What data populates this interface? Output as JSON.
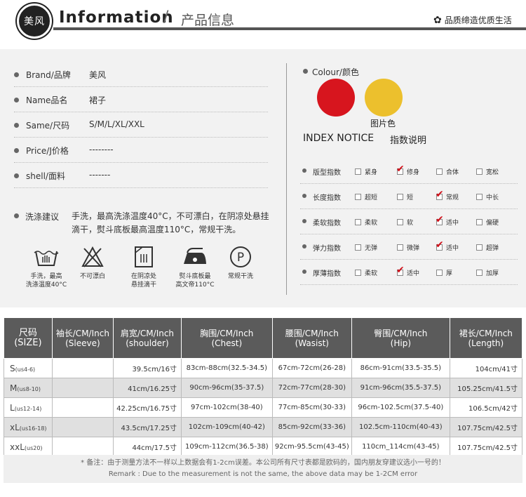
{
  "header": {
    "logo_text": "美风",
    "title_en": "Information",
    "title_slash": "/",
    "title_cn": "产品信息",
    "slogan": "品质缔造优质生活",
    "slogan_icon": "flower-icon"
  },
  "info": {
    "rows": [
      {
        "label": "Brand/品牌",
        "value": "美风"
      },
      {
        "label": "Name品名",
        "value": "裙子"
      },
      {
        "label": "Same/尺码",
        "value": "S/M/L/XL/XXL"
      },
      {
        "label": "Price/J价格",
        "value": "--------"
      },
      {
        "label": "shell/面料",
        "value": "-------"
      }
    ],
    "wash_label": "洗涤建议",
    "wash_text": "手洗，最高洗涤温度40°C，不可漂白，在阴凉处悬挂滴干，熨斗底板最高温度110°C，常规干洗。"
  },
  "care": [
    {
      "icon": "hand-wash-icon",
      "line1": "手洗，最高",
      "line2": "洗涤温度40°C"
    },
    {
      "icon": "no-bleach-icon",
      "line1": "不可漂白",
      "line2": ""
    },
    {
      "icon": "drip-dry-shade-icon",
      "line1": "在阴凉处",
      "line2": "悬挂滴干"
    },
    {
      "icon": "iron-icon",
      "line1": "熨斗底板最",
      "line2": "高文帝110°C"
    },
    {
      "icon": "dry-clean-icon",
      "line1": "常规干洗",
      "line2": ""
    }
  ],
  "colour": {
    "label": "Colour/颜色",
    "swatches": [
      "#d7151e",
      "#ecc02d"
    ],
    "caption": "图片色"
  },
  "index": {
    "title_en": "INDEX NOTICE",
    "title_cn": "指数说明",
    "rows": [
      {
        "name": "版型指数",
        "options": [
          "紧身",
          "修身",
          "合体",
          "宽松"
        ],
        "checked": 1
      },
      {
        "name": "长度指数",
        "options": [
          "超短",
          "短",
          "常规",
          "中长"
        ],
        "checked": 2
      },
      {
        "name": "柔软指数",
        "options": [
          "柔软",
          "软",
          "适中",
          "偏硬"
        ],
        "checked": 2
      },
      {
        "name": "弹力指数",
        "options": [
          "无弹",
          "微弹",
          "适中",
          "超弹"
        ],
        "checked": 2
      },
      {
        "name": "厚薄指数",
        "options": [
          "柔软",
          "适中",
          "厚",
          "加厚"
        ],
        "checked": 1
      }
    ]
  },
  "size_table": {
    "headers": [
      {
        "cn": "尺码",
        "en": "(SIZE)"
      },
      {
        "cn": "袖长/CM/Inch",
        "en": "(Sleeve)"
      },
      {
        "cn": "肩宽/CM/Inch",
        "en": "(shoulder)"
      },
      {
        "cn": "胸围/CM/Inch",
        "en": "(Chest)"
      },
      {
        "cn": "腰围/CM/Inch",
        "en": "(Wasist)"
      },
      {
        "cn": "臀围/CM/Inch",
        "en": "(Hip)"
      },
      {
        "cn": "裙长/CM/Inch",
        "en": "(Length)"
      }
    ],
    "rows": [
      {
        "size": "S",
        "us": "(us4-6)",
        "sleeve": "",
        "shoulder": "39.5cm/16寸",
        "chest": "83cm-88cm(32.5-34.5)",
        "waist": "67cm-72cm(26-28)",
        "hip": "86cm-91cm(33.5-35.5)",
        "length": "104cm/41寸"
      },
      {
        "size": "M",
        "us": "(us8-10)",
        "sleeve": "",
        "shoulder": "41cm/16.25寸",
        "chest": "90cm-96cm(35-37.5)",
        "waist": "72cm-77cm(28-30)",
        "hip": "91cm-96cm(35.5-37.5)",
        "length": "105.25cm/41.5寸"
      },
      {
        "size": "L",
        "us": "(us12-14)",
        "sleeve": "",
        "shoulder": "42.25cm/16.75寸",
        "chest": "97cm-102cm(38-40)",
        "waist": "77cm-85cm(30-33)",
        "hip": "96cm-102.5cm(37.5-40)",
        "length": "106.5cm/42寸"
      },
      {
        "size": "xL",
        "us": "(us16-18)",
        "sleeve": "",
        "shoulder": "43.5cm/17.25寸",
        "chest": "102cm-109cm(40-42)",
        "waist": "85cm-92cm(33-36)",
        "hip": "102.5cm-110cm(40-43)",
        "length": "107.75cm/42.5寸"
      },
      {
        "size": "xxL",
        "us": "(us20)",
        "sleeve": "",
        "shoulder": "44cm/17.5寸",
        "chest": "109cm-112cm(36.5-38)",
        "waist": "92cm-95.5cm(43-45)",
        "hip": "110cm_114cm(43-45)",
        "length": "107.75cm/42.5寸"
      }
    ],
    "note_cn": "* 备注：由于测量方法不一样以上数据会有1-2cm误差。本公司所有尺寸表都是欧码的，国内朋友穿建议选小一号的！",
    "note_en": "Remark : Due to the measurement is not the same, the above data may be 1-2CM error"
  }
}
